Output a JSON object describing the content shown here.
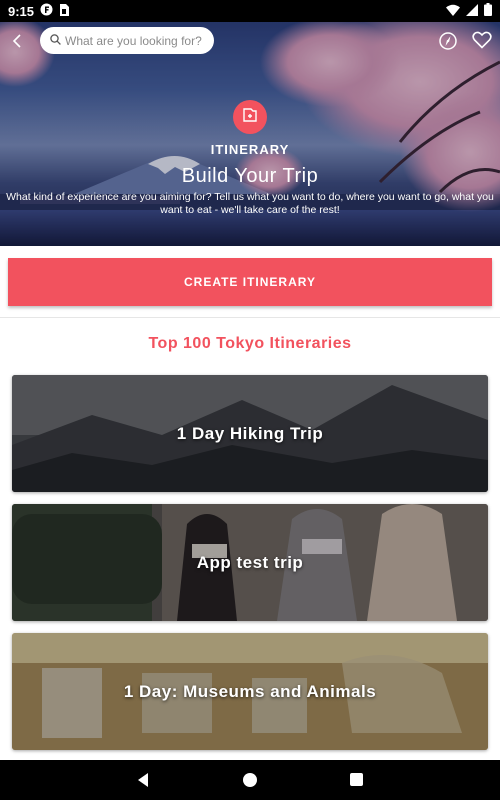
{
  "status_bar": {
    "time": "9:15",
    "icons": [
      "notification-f-icon",
      "sim-card-icon",
      "wifi-icon",
      "signal-icon",
      "battery-icon"
    ]
  },
  "topbar": {
    "search": {
      "placeholder": "What are you looking for?",
      "value": ""
    },
    "icons": [
      "back-arrow-icon",
      "search-icon",
      "compass-icon",
      "heart-icon"
    ]
  },
  "hero": {
    "badge_icon": "itinerary-icon",
    "label": "ITINERARY",
    "title": "Build Your Trip",
    "description": "What kind of experience are you aiming for? Tell us what you want to do, where you want to go, what you want to eat - we'll take care of the rest!"
  },
  "actions": {
    "create_label": "CREATE ITINERARY"
  },
  "section": {
    "title": "Top 100 Tokyo Itineraries"
  },
  "itineraries": [
    {
      "title": "1 Day Hiking Trip"
    },
    {
      "title": "App test trip"
    },
    {
      "title": "1 Day: Museums and Animals"
    }
  ],
  "nav_bar": {
    "icons": [
      "nav-back-icon",
      "nav-home-icon",
      "nav-recents-icon"
    ]
  },
  "colors": {
    "accent": "#f2525e",
    "status_bar": "#000000",
    "background": "#ffffff"
  }
}
